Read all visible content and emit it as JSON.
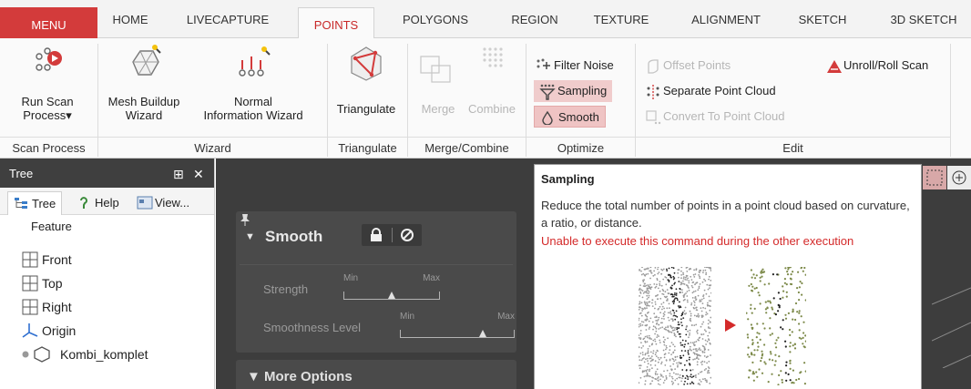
{
  "tabs": {
    "menu": "MENU",
    "items": [
      "HOME",
      "LIVECAPTURE",
      "POINTS",
      "POLYGONS",
      "REGION",
      "TEXTURE",
      "ALIGNMENT",
      "SKETCH",
      "3D SKETCH"
    ],
    "active": "POINTS"
  },
  "ribbon": {
    "run_scan": "Run Scan\nProcess▾",
    "mesh_buildup": "Mesh Buildup\nWizard",
    "normal_info": "Normal\nInformation Wizard",
    "triangulate": "Triangulate",
    "merge": "Merge",
    "combine": "Combine",
    "filter_noise": "Filter Noise",
    "sampling": "Sampling",
    "smooth": "Smooth",
    "offset_points": "Offset Points",
    "separate_point_cloud": "Separate Point Cloud",
    "convert_to_point_cloud": "Convert To Point Cloud",
    "unroll_roll_scan": "Unroll/Roll Scan",
    "groups": {
      "scan_process": "Scan Process",
      "wizard": "Wizard",
      "triangulate": "Triangulate",
      "merge_combine": "Merge/Combine",
      "optimize": "Optimize",
      "edit": "Edit"
    }
  },
  "tree_panel": {
    "title": "Tree",
    "pin": "⊞",
    "close": "✕",
    "tabs": [
      "Tree",
      "Help",
      "View..."
    ],
    "column": "Feature",
    "nodes": [
      "Front",
      "Top",
      "Right",
      "Origin",
      "Kombi_komplet"
    ]
  },
  "smooth_panel": {
    "title": "Smooth",
    "strength_label": "Strength",
    "smoothness_label": "Smoothness Level",
    "min": "Min",
    "max": "Max",
    "strength_value": 0.5,
    "smoothness_value": 0.72,
    "more_options": "▼ More Options"
  },
  "tooltip": {
    "title": "Sampling",
    "description": "Reduce the total number of points in a point cloud based on curvature, a ratio, or distance.",
    "warning": "Unable to execute this command during the other execution"
  },
  "colors": {
    "accent": "#d33b3b",
    "active_tab_text": "#c82828",
    "highlight": "#f0cccc",
    "warning": "#d42a2a"
  }
}
